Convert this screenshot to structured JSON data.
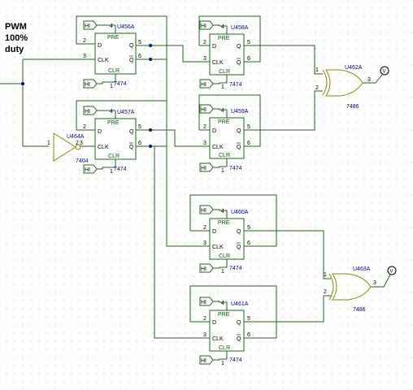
{
  "title": {
    "line1": "PWM",
    "line2": "100%",
    "line3": "duty"
  },
  "flipflops": [
    {
      "ref": "U456A",
      "part": "7474"
    },
    {
      "ref": "U457A",
      "part": "7474"
    },
    {
      "ref": "U458A",
      "part": "7474"
    },
    {
      "ref": "U459A",
      "part": "7474"
    },
    {
      "ref": "U460A",
      "part": "7474"
    },
    {
      "ref": "U461A",
      "part": "7474"
    }
  ],
  "ff_pins": {
    "pre": "PRE",
    "d": "D",
    "clk": "CLK",
    "q": "Q",
    "qbar": "Q",
    "clr": "CLR",
    "n_pre": "4",
    "n_d": "2",
    "n_clk": "3",
    "n_q": "5",
    "n_qbar": "6",
    "n_clr": "1"
  },
  "hi_label": "HI",
  "inverter": {
    "ref": "U464A",
    "part": "7404",
    "pin_in": "1",
    "pin_out": "2",
    "pin_extra": "3"
  },
  "xor_gates": [
    {
      "ref": "U462A",
      "part": "7486",
      "pin_a": "1",
      "pin_b": "2",
      "pin_out": "3"
    },
    {
      "ref": "U463A",
      "part": "7486",
      "pin_a": "1",
      "pin_b": "2",
      "pin_out": "3"
    }
  ],
  "probe_label": "V"
}
